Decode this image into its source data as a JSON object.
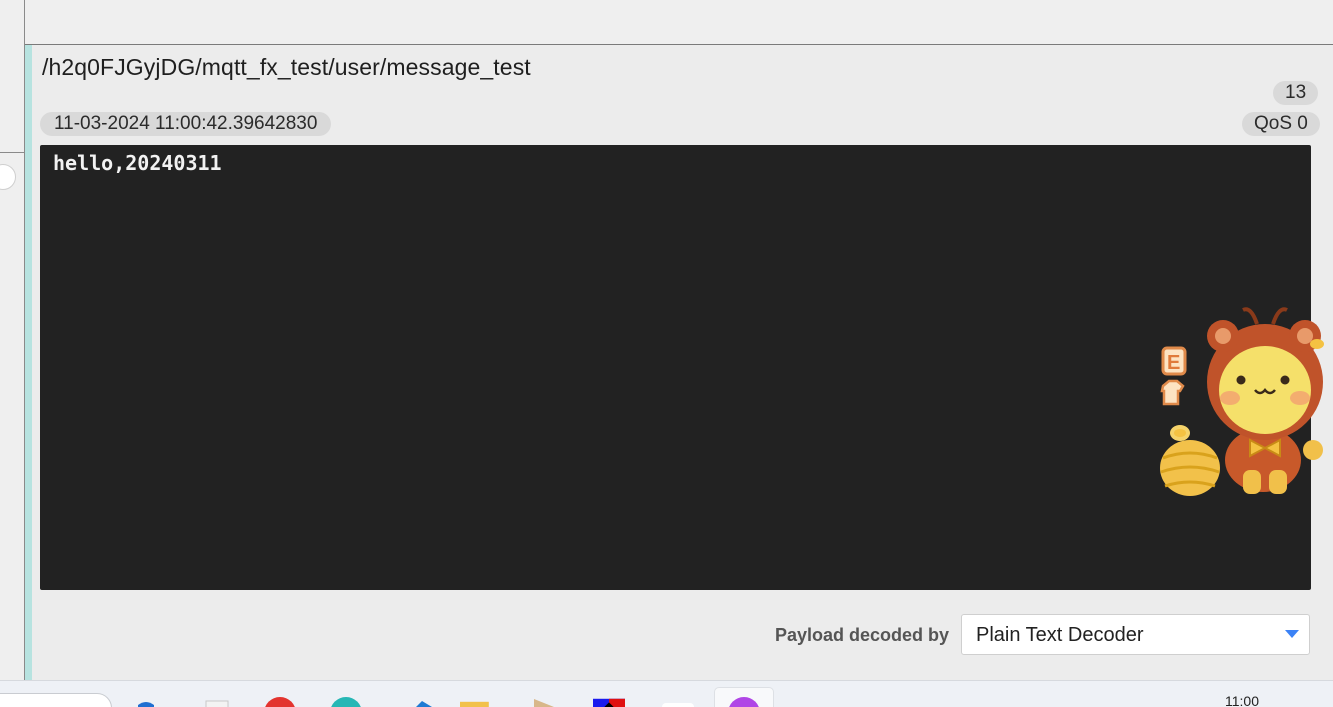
{
  "message": {
    "topic": "/h2q0FJGyjDG/mqtt_fx_test/user/message_test",
    "count": "13",
    "timestamp": "11-03-2024  11:00:42.39642830",
    "qos": "QoS 0",
    "payload": "hello,20240311"
  },
  "decoder": {
    "label": "Payload decoded by",
    "selected": "Plain Text Decoder"
  },
  "taskbar": {
    "clock": "11:00",
    "icons": [
      "search-box",
      "copilot-icon",
      "file-icon",
      "red-app-icon",
      "edge-icon",
      "vscode-icon",
      "file-explorer-icon",
      "folder-icon",
      "app-icon",
      "white-app-icon",
      "purple-app-icon"
    ]
  },
  "colors": {
    "accent_bar": "#b7e3e0",
    "payload_bg": "#222222",
    "dropdown_arrow": "#3b82f6"
  }
}
